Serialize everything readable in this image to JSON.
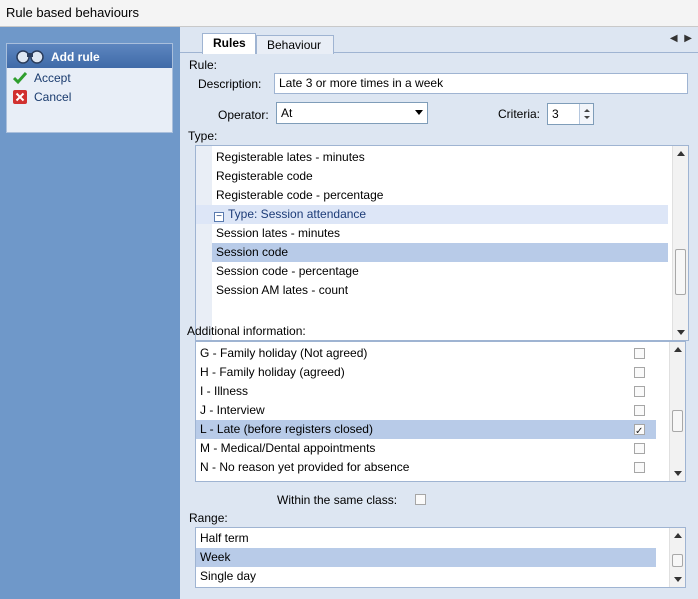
{
  "window": {
    "title": "Rule based behaviours"
  },
  "commands": {
    "header": "Add rule",
    "accept": "Accept",
    "cancel": "Cancel",
    "accept_color": "#2e9e2e",
    "cancel_color": "#d13030"
  },
  "tabs": [
    {
      "label": "Rules",
      "active": true
    },
    {
      "label": "Behaviour",
      "active": false
    }
  ],
  "rule": {
    "section_label": "Rule:",
    "description_label": "Description:",
    "description_value": "Late 3 or more times in a week",
    "operator_label": "Operator:",
    "operator_value": "At",
    "criteria_label": "Criteria:",
    "criteria_value": "3"
  },
  "type": {
    "label": "Type:",
    "items": [
      {
        "text": "Registerable lates - minutes",
        "kind": "item"
      },
      {
        "text": "Registerable code",
        "kind": "item"
      },
      {
        "text": "Registerable code - percentage",
        "kind": "item"
      },
      {
        "text": "Type: Session attendance",
        "kind": "group"
      },
      {
        "text": "Session lates - minutes",
        "kind": "item"
      },
      {
        "text": "Session code",
        "kind": "selected"
      },
      {
        "text": "Session code - percentage",
        "kind": "item"
      },
      {
        "text": "Session AM lates - count",
        "kind": "item"
      }
    ]
  },
  "additional": {
    "label": "Additional information:",
    "items": [
      {
        "text": "G - Family holiday (Not agreed)",
        "checked": false,
        "selected": false
      },
      {
        "text": "H - Family holiday (agreed)",
        "checked": false,
        "selected": false
      },
      {
        "text": "I - Illness",
        "checked": false,
        "selected": false
      },
      {
        "text": "J - Interview",
        "checked": false,
        "selected": false
      },
      {
        "text": "L - Late (before registers closed)",
        "checked": true,
        "selected": true
      },
      {
        "text": "M - Medical/Dental appointments",
        "checked": false,
        "selected": false
      },
      {
        "text": "N - No reason yet provided for absence",
        "checked": false,
        "selected": false
      }
    ]
  },
  "same_class": {
    "label": "Within the same class:",
    "checked": false
  },
  "range": {
    "label": "Range:",
    "items": [
      {
        "text": "Half term",
        "selected": false
      },
      {
        "text": "Week",
        "selected": true
      },
      {
        "text": "Single day",
        "selected": false
      }
    ]
  }
}
